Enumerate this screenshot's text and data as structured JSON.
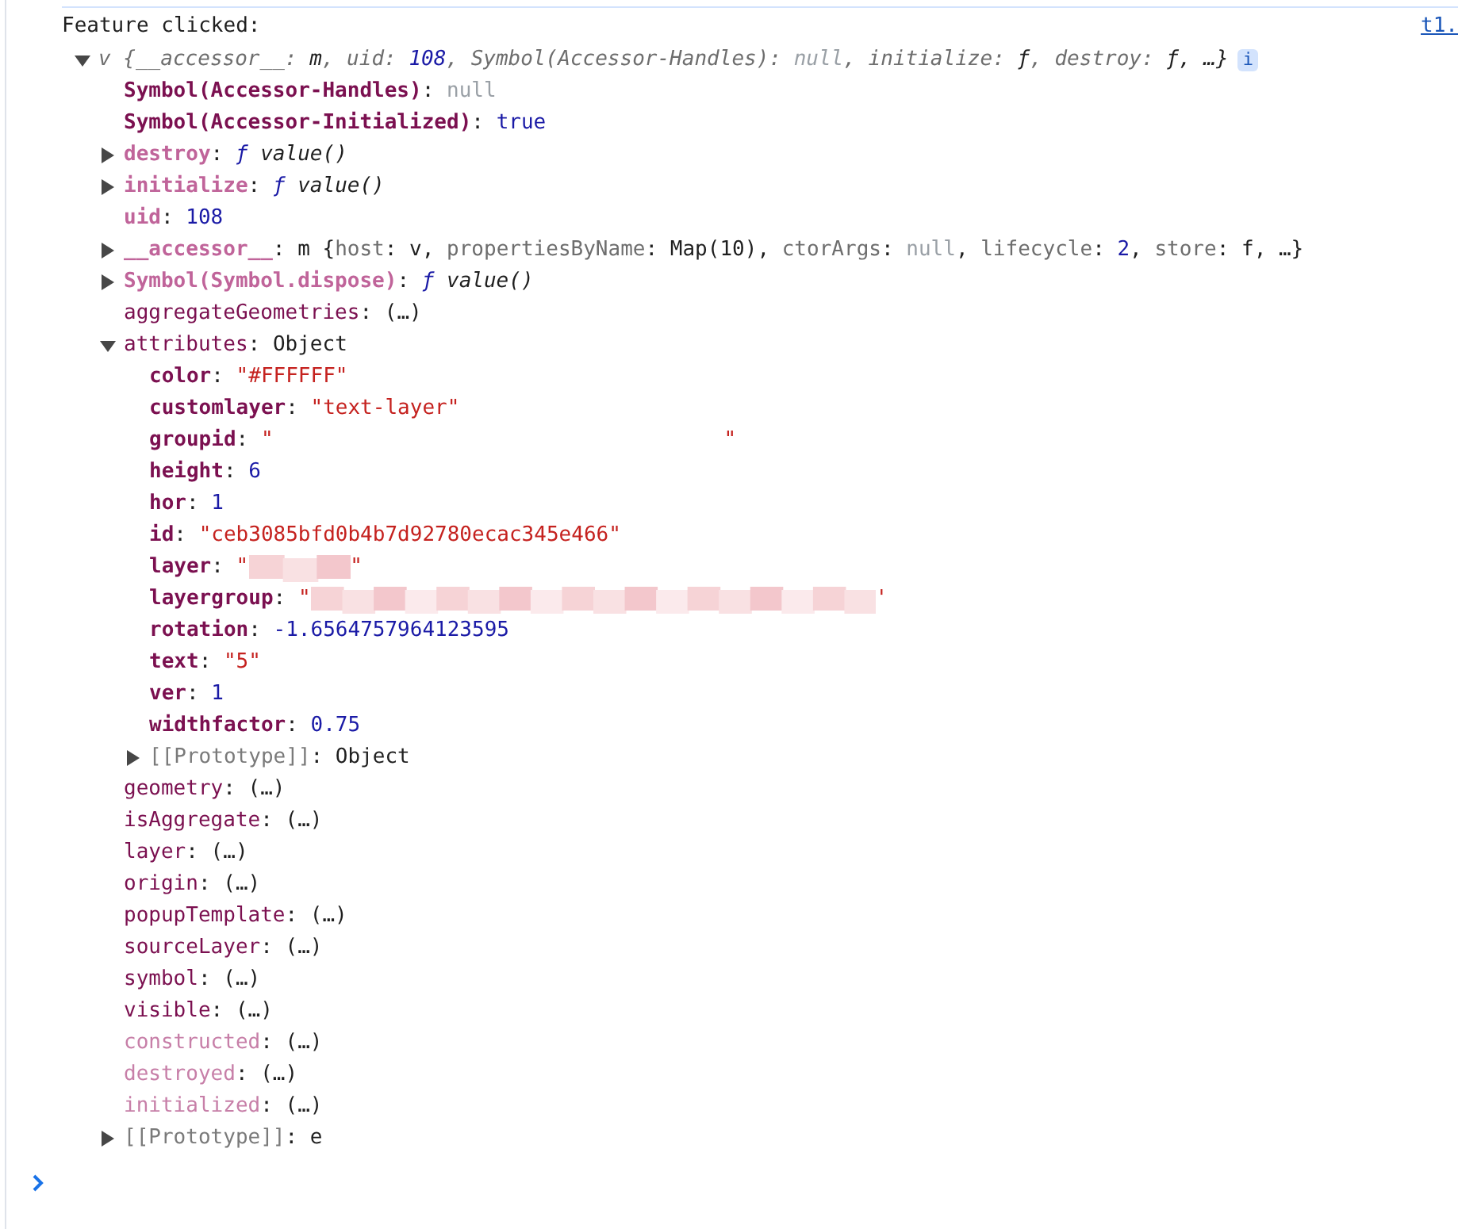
{
  "message": {
    "text": "Feature clicked:",
    "source": "t1."
  },
  "object": {
    "kind": "summary",
    "expanded": true,
    "badge": "i",
    "value": [
      {
        "text": "v ",
        "kind": "key"
      },
      {
        "text": "{",
        "kind": "key"
      },
      {
        "text": "__accessor__",
        "kind": "key"
      },
      {
        "text": ": ",
        "kind": "key"
      },
      {
        "text": "m",
        "kind": "plain"
      },
      {
        "text": ", ",
        "kind": "key"
      },
      {
        "text": "uid",
        "kind": "key"
      },
      {
        "text": ": ",
        "kind": "key"
      },
      {
        "text": "108",
        "kind": "number"
      },
      {
        "text": ", ",
        "kind": "key"
      },
      {
        "text": "Symbol(Accessor-Handles)",
        "kind": "key"
      },
      {
        "text": ": ",
        "kind": "key"
      },
      {
        "text": "null",
        "kind": "null"
      },
      {
        "text": ", ",
        "kind": "key"
      },
      {
        "text": "initialize",
        "kind": "key"
      },
      {
        "text": ": ",
        "kind": "key"
      },
      {
        "text": "ƒ",
        "kind": "plain"
      },
      {
        "text": ", ",
        "kind": "key"
      },
      {
        "text": "destroy",
        "kind": "key"
      },
      {
        "text": ": ",
        "kind": "key"
      },
      {
        "text": "ƒ",
        "kind": "plain"
      },
      {
        "text": ", …}",
        "kind": "plain"
      }
    ],
    "children": [
      {
        "key": "Symbol(Accessor-Handles)",
        "kind": "own",
        "value": [
          {
            "text": ": ",
            "kind": "plain"
          },
          {
            "text": "null",
            "kind": "null"
          }
        ]
      },
      {
        "key": "Symbol(Accessor-Initialized)",
        "kind": "own",
        "value": [
          {
            "text": ": ",
            "kind": "plain"
          },
          {
            "text": "true",
            "kind": "number"
          }
        ]
      },
      {
        "key": "destroy",
        "kind": "hidden",
        "expanded": false,
        "value": [
          {
            "text": ": ",
            "kind": "plain"
          },
          {
            "text": "ƒ ",
            "kind": "fn"
          },
          {
            "text": "value()",
            "kind": "body"
          }
        ]
      },
      {
        "key": "initialize",
        "kind": "hidden",
        "expanded": false,
        "value": [
          {
            "text": ": ",
            "kind": "plain"
          },
          {
            "text": "ƒ ",
            "kind": "fn"
          },
          {
            "text": "value()",
            "kind": "body"
          }
        ]
      },
      {
        "key": "uid",
        "kind": "hidden",
        "value": [
          {
            "text": ": ",
            "kind": "plain"
          },
          {
            "text": "108",
            "kind": "number"
          }
        ]
      },
      {
        "key": "__accessor__",
        "kind": "hidden",
        "expanded": false,
        "value": [
          {
            "text": ": ",
            "kind": "plain"
          },
          {
            "text": "m ",
            "kind": "plain"
          },
          {
            "text": "{",
            "kind": "plain"
          },
          {
            "text": "host",
            "kind": "key"
          },
          {
            "text": ": ",
            "kind": "plain"
          },
          {
            "text": "v",
            "kind": "plain"
          },
          {
            "text": ", ",
            "kind": "plain"
          },
          {
            "text": "propertiesByName",
            "kind": "key"
          },
          {
            "text": ": ",
            "kind": "plain"
          },
          {
            "text": "Map(10)",
            "kind": "plain"
          },
          {
            "text": ", ",
            "kind": "plain"
          },
          {
            "text": "ctorArgs",
            "kind": "key"
          },
          {
            "text": ": ",
            "kind": "plain"
          },
          {
            "text": "null",
            "kind": "null"
          },
          {
            "text": ", ",
            "kind": "plain"
          },
          {
            "text": "lifecycle",
            "kind": "key"
          },
          {
            "text": ": ",
            "kind": "plain"
          },
          {
            "text": "2",
            "kind": "number"
          },
          {
            "text": ", ",
            "kind": "plain"
          },
          {
            "text": "store",
            "kind": "key"
          },
          {
            "text": ": ",
            "kind": "plain"
          },
          {
            "text": "f",
            "kind": "plain"
          },
          {
            "text": ", …}",
            "kind": "plain"
          }
        ]
      },
      {
        "key": "Symbol(Symbol.dispose)",
        "kind": "hidden",
        "expanded": false,
        "value": [
          {
            "text": ": ",
            "kind": "plain"
          },
          {
            "text": "ƒ ",
            "kind": "fn"
          },
          {
            "text": "value()",
            "kind": "body"
          }
        ]
      },
      {
        "key": "aggregateGeometries",
        "kind": "getter",
        "value": [
          {
            "text": ": ",
            "kind": "plain"
          },
          {
            "text": " (…)",
            "kind": "plain"
          }
        ]
      },
      {
        "key": "attributes",
        "kind": "getter",
        "expanded": true,
        "value": [
          {
            "text": ": ",
            "kind": "plain"
          },
          {
            "text": "Object",
            "kind": "plain"
          }
        ],
        "children": [
          {
            "key": "color",
            "kind": "own",
            "value": [
              {
                "text": ": ",
                "kind": "plain"
              },
              {
                "text": "\"#FFFFFF\"",
                "kind": "string"
              }
            ]
          },
          {
            "key": "customlayer",
            "kind": "own",
            "value": [
              {
                "text": ": ",
                "kind": "plain"
              },
              {
                "text": "\"text-layer\"",
                "kind": "string"
              }
            ]
          },
          {
            "key": "groupid",
            "kind": "own",
            "value": [
              {
                "text": ": ",
                "kind": "plain"
              },
              {
                "text": "\"",
                "kind": "string"
              },
              {
                "kind": "gap"
              },
              {
                "text": "\"",
                "kind": "string"
              }
            ]
          },
          {
            "key": "height",
            "kind": "own",
            "value": [
              {
                "text": ": ",
                "kind": "plain"
              },
              {
                "text": "6",
                "kind": "number"
              }
            ]
          },
          {
            "key": "hor",
            "kind": "own",
            "value": [
              {
                "text": ": ",
                "kind": "plain"
              },
              {
                "text": "1",
                "kind": "number"
              }
            ]
          },
          {
            "key": "id",
            "kind": "own",
            "value": [
              {
                "text": ": ",
                "kind": "plain"
              },
              {
                "text": "\"ceb3085bfd0b4b7d92780ecac345e466\"",
                "kind": "string"
              }
            ]
          },
          {
            "key": "layer",
            "kind": "own",
            "value": [
              {
                "text": ": ",
                "kind": "plain"
              },
              {
                "text": "\"",
                "kind": "string"
              },
              {
                "kind": "smudge"
              },
              {
                "text": "\"",
                "kind": "string"
              }
            ]
          },
          {
            "key": "layergroup",
            "kind": "own",
            "value": [
              {
                "text": ": ",
                "kind": "plain"
              },
              {
                "text": "\"",
                "kind": "string"
              },
              {
                "kind": "band"
              },
              {
                "text": "'",
                "kind": "string"
              }
            ]
          },
          {
            "key": "rotation",
            "kind": "own",
            "value": [
              {
                "text": ": ",
                "kind": "plain"
              },
              {
                "text": "-1.6564757964123595",
                "kind": "number"
              }
            ]
          },
          {
            "key": "text",
            "kind": "own",
            "value": [
              {
                "text": ": ",
                "kind": "plain"
              },
              {
                "text": "\"5\"",
                "kind": "string"
              }
            ]
          },
          {
            "key": "ver",
            "kind": "own",
            "value": [
              {
                "text": ": ",
                "kind": "plain"
              },
              {
                "text": "1",
                "kind": "number"
              }
            ]
          },
          {
            "key": "widthfactor",
            "kind": "own",
            "value": [
              {
                "text": ": ",
                "kind": "plain"
              },
              {
                "text": "0.75",
                "kind": "number"
              }
            ]
          },
          {
            "key": "[[Prototype]]",
            "kind": "internal",
            "expanded": false,
            "value": [
              {
                "text": ": ",
                "kind": "plain"
              },
              {
                "text": "Object",
                "kind": "plain"
              }
            ]
          }
        ]
      },
      {
        "key": "geometry",
        "kind": "getter",
        "value": [
          {
            "text": ": ",
            "kind": "plain"
          },
          {
            "text": " (…)",
            "kind": "plain"
          }
        ]
      },
      {
        "key": "isAggregate",
        "kind": "getter",
        "value": [
          {
            "text": ": ",
            "kind": "plain"
          },
          {
            "text": " (…)",
            "kind": "plain"
          }
        ]
      },
      {
        "key": "layer",
        "kind": "getter",
        "value": [
          {
            "text": ": ",
            "kind": "plain"
          },
          {
            "text": " (…)",
            "kind": "plain"
          }
        ]
      },
      {
        "key": "origin",
        "kind": "getter",
        "value": [
          {
            "text": ": ",
            "kind": "plain"
          },
          {
            "text": " (…)",
            "kind": "plain"
          }
        ]
      },
      {
        "key": "popupTemplate",
        "kind": "getter",
        "value": [
          {
            "text": ": ",
            "kind": "plain"
          },
          {
            "text": " (…)",
            "kind": "plain"
          }
        ]
      },
      {
        "key": "sourceLayer",
        "kind": "getter",
        "value": [
          {
            "text": ": ",
            "kind": "plain"
          },
          {
            "text": " (…)",
            "kind": "plain"
          }
        ]
      },
      {
        "key": "symbol",
        "kind": "getter",
        "value": [
          {
            "text": ": ",
            "kind": "plain"
          },
          {
            "text": " (…)",
            "kind": "plain"
          }
        ]
      },
      {
        "key": "visible",
        "kind": "getter",
        "value": [
          {
            "text": ": ",
            "kind": "plain"
          },
          {
            "text": " (…)",
            "kind": "plain"
          }
        ]
      },
      {
        "key": "constructed",
        "kind": "inherited",
        "value": [
          {
            "text": ": ",
            "kind": "plain"
          },
          {
            "text": " (…)",
            "kind": "plain"
          }
        ]
      },
      {
        "key": "destroyed",
        "kind": "inherited",
        "value": [
          {
            "text": ": ",
            "kind": "plain"
          },
          {
            "text": " (…)",
            "kind": "plain"
          }
        ]
      },
      {
        "key": "initialized",
        "kind": "inherited",
        "value": [
          {
            "text": ": ",
            "kind": "plain"
          },
          {
            "text": " (…)",
            "kind": "plain"
          }
        ]
      },
      {
        "key": "[[Prototype]]",
        "kind": "internal",
        "expanded": false,
        "value": [
          {
            "text": ": ",
            "kind": "plain"
          },
          {
            "text": "e",
            "kind": "plain"
          }
        ]
      }
    ]
  }
}
